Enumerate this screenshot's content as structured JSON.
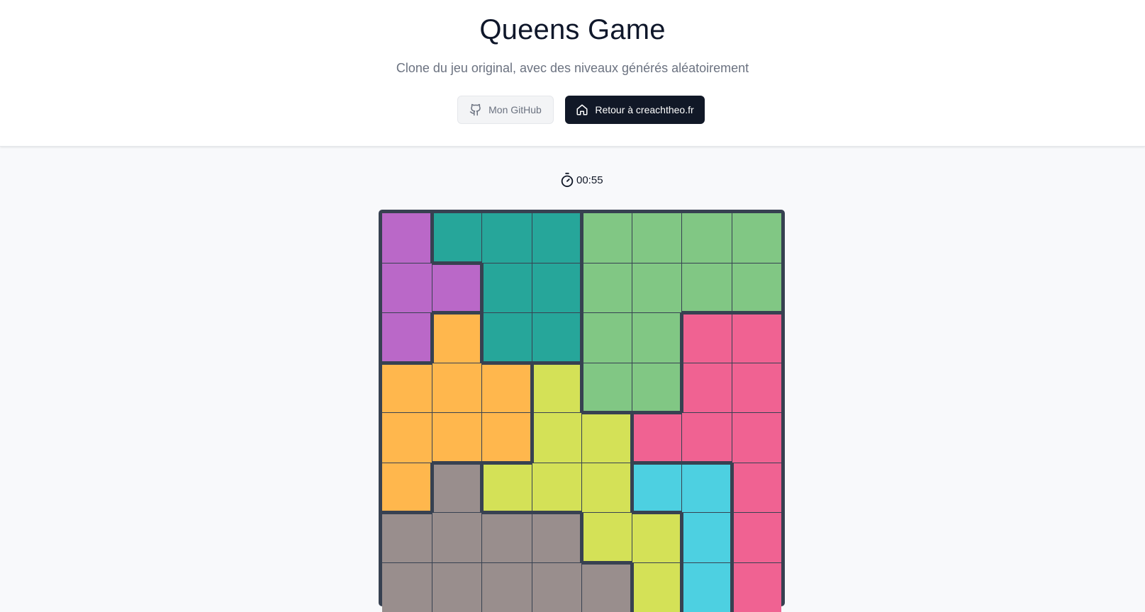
{
  "header": {
    "title": "Queens Game",
    "subtitle": "Clone du jeu original, avec des niveaux générés aléatoirement",
    "github_label": "Mon GitHub",
    "home_label": "Retour à creachtheo.fr",
    "github_icon": "github-icon",
    "home_icon": "home-icon"
  },
  "timer": {
    "icon": "stopwatch-icon",
    "value": "00:55"
  },
  "board": {
    "size": 8,
    "region_colors": {
      "purple": "#ba68c8",
      "teal": "#26a69a",
      "green": "#81c784",
      "pink": "#f06292",
      "orange": "#ffb74d",
      "lime": "#d4e157",
      "gray": "#998e8d",
      "cyan": "#4dd0e1"
    },
    "grid": [
      [
        "purple",
        "teal",
        "teal",
        "teal",
        "green",
        "green",
        "green",
        "green"
      ],
      [
        "purple",
        "purple",
        "teal",
        "teal",
        "green",
        "green",
        "green",
        "green"
      ],
      [
        "purple",
        "orange",
        "teal",
        "teal",
        "green",
        "green",
        "pink",
        "pink"
      ],
      [
        "orange",
        "orange",
        "orange",
        "lime",
        "green",
        "green",
        "pink",
        "pink"
      ],
      [
        "orange",
        "orange",
        "orange",
        "lime",
        "lime",
        "pink",
        "pink",
        "pink"
      ],
      [
        "orange",
        "gray",
        "lime",
        "lime",
        "lime",
        "cyan",
        "cyan",
        "pink"
      ],
      [
        "gray",
        "gray",
        "gray",
        "gray",
        "lime",
        "lime",
        "cyan",
        "pink"
      ],
      [
        "gray",
        "gray",
        "gray",
        "gray",
        "gray",
        "lime",
        "cyan",
        "pink"
      ]
    ]
  }
}
